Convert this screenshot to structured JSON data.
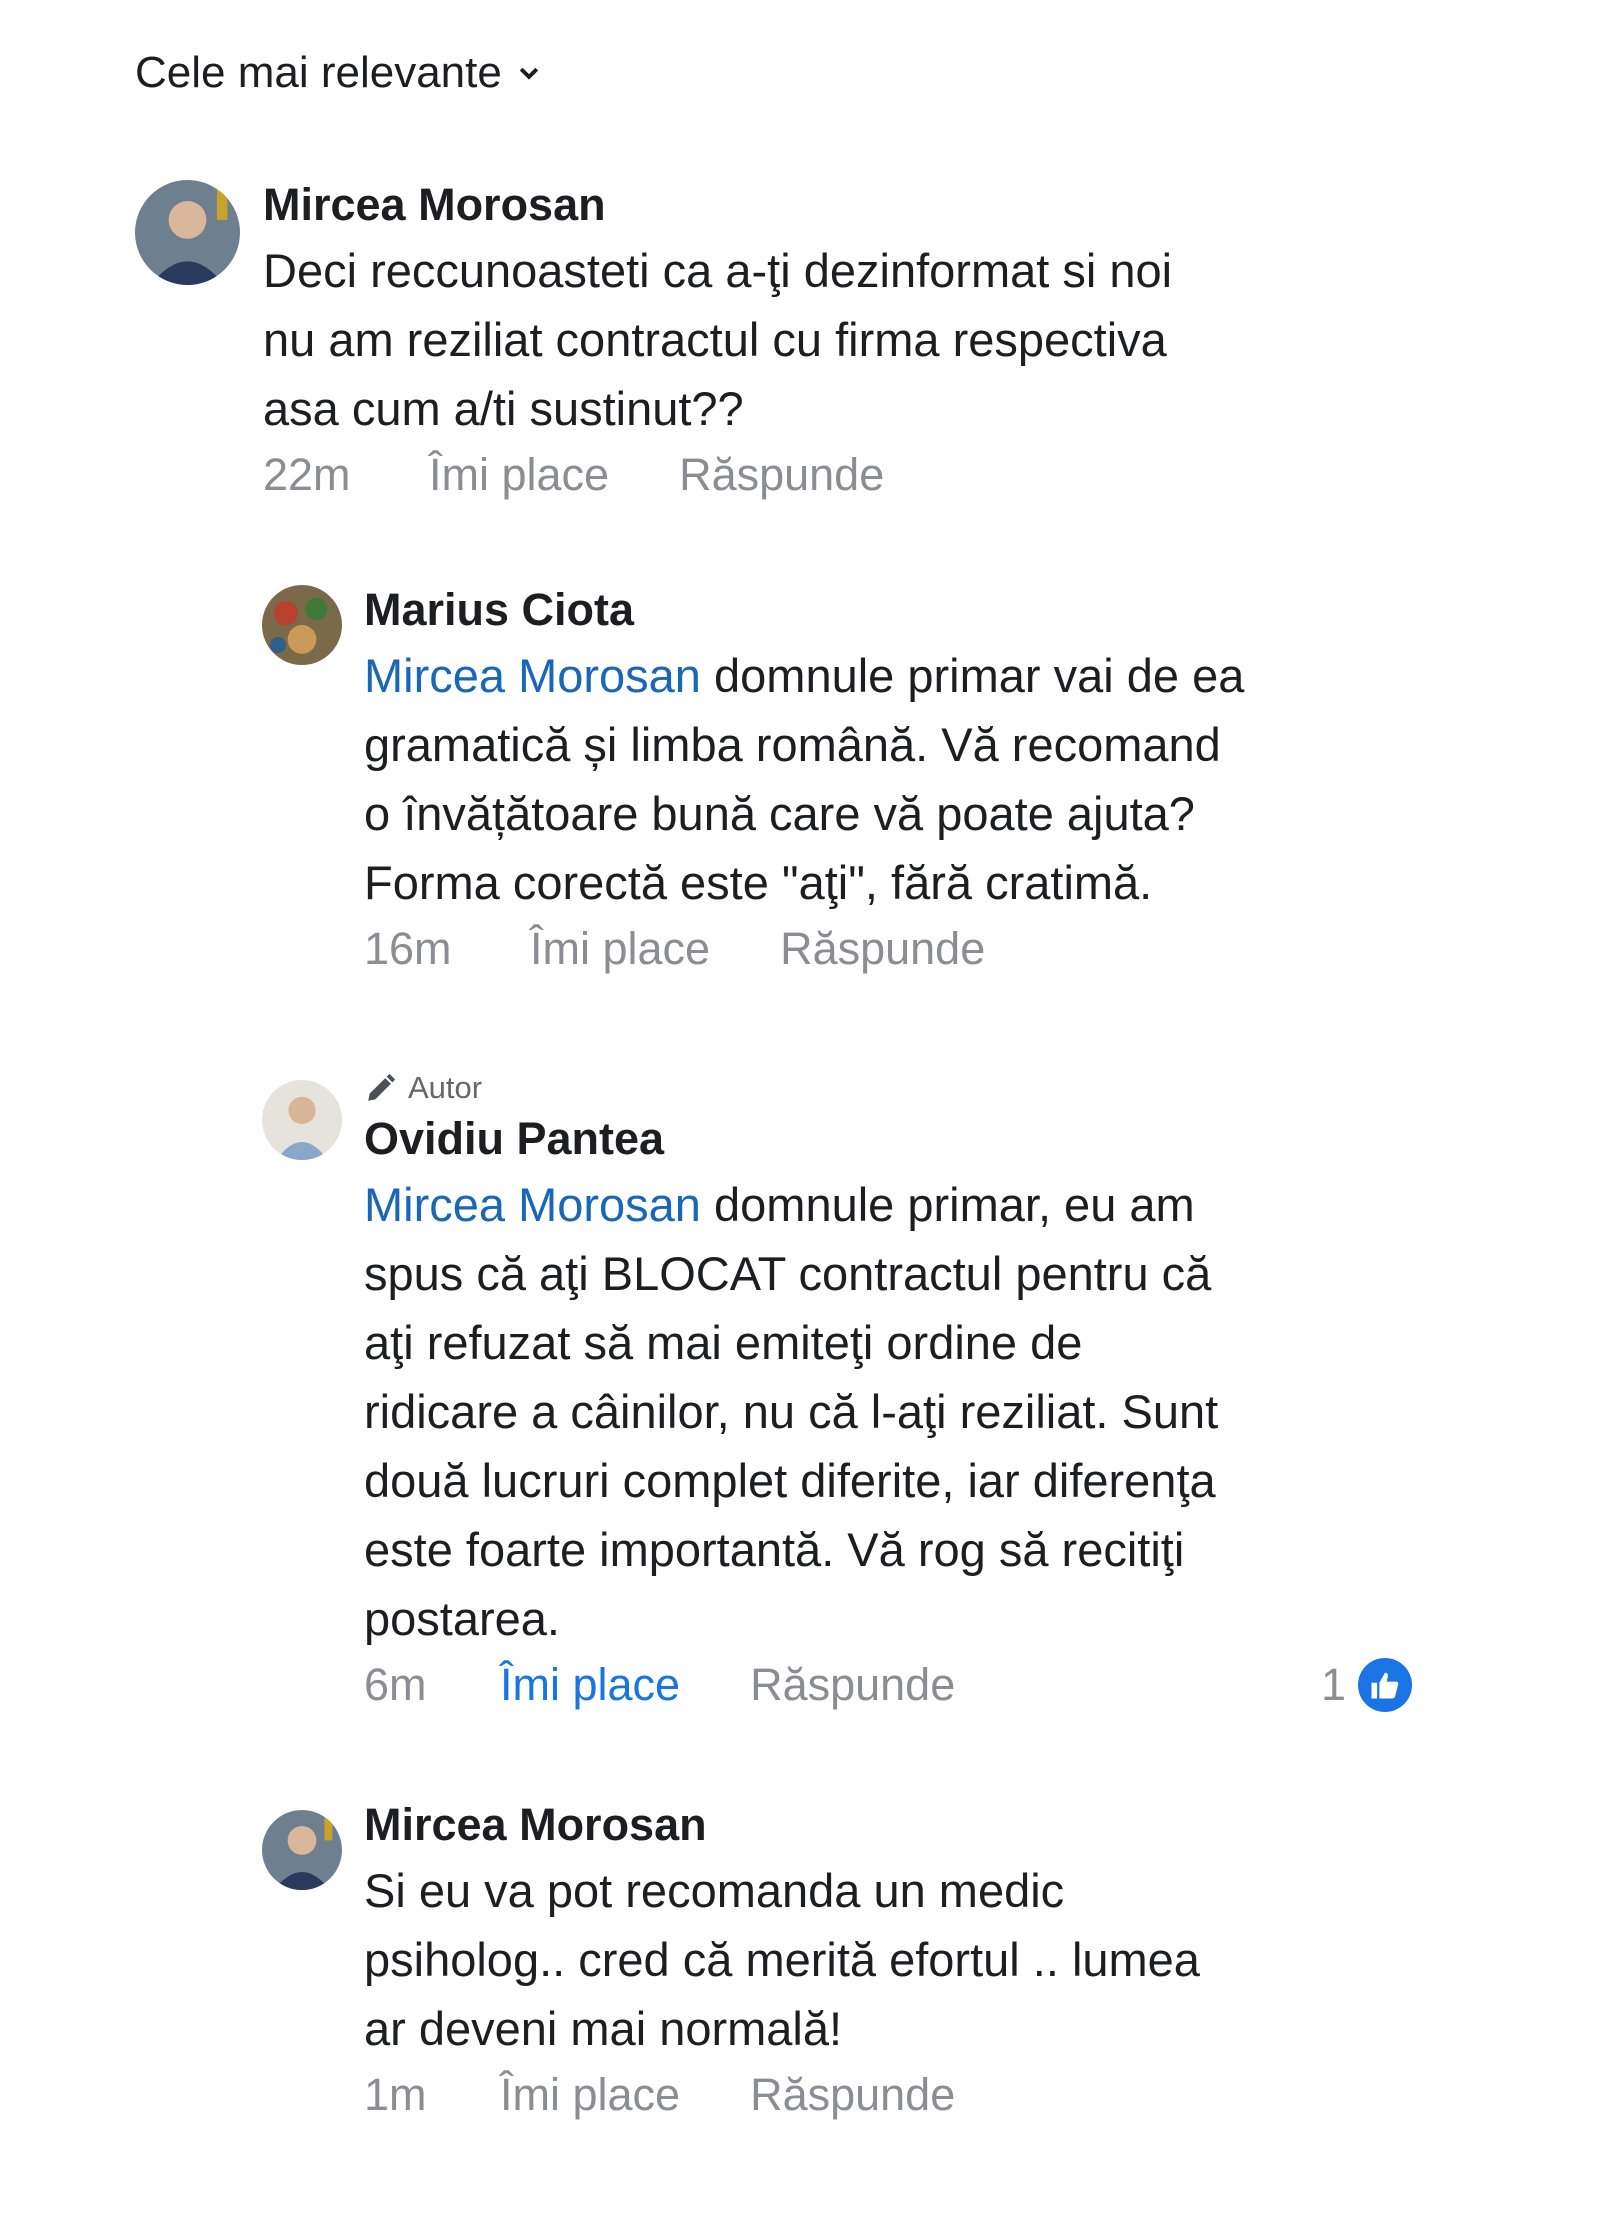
{
  "sort": {
    "label": "Cele mai relevante"
  },
  "comments": [
    {
      "name": "Mircea Morosan",
      "mention": "",
      "text": "Deci reccunoasteti ca a-ţi dezinformat si noi\nnu am reziliat contractul cu firma respectiva\nasa cum a/ti sustinut??",
      "time": "22m",
      "like": "Îmi place",
      "reply": "Răspunde"
    },
    {
      "name": "Marius Ciota",
      "mention": "Mircea Morosan",
      "text": " domnule primar vai de ea\ngramatică și limba română. Vă recomand\no învățătoare bună care vă poate ajuta?\nForma corectă este \"aţi\", fără cratimă.",
      "time": "16m",
      "like": "Îmi place",
      "reply": "Răspunde"
    },
    {
      "badge": "Autor",
      "name": "Ovidiu Pantea",
      "mention": "Mircea Morosan",
      "text": " domnule primar, eu am\nspus că aţi BLOCAT contractul pentru că\naţi refuzat să mai emiteţi ordine de\nridicare a câinilor, nu că l-aţi reziliat. Sunt\ndouă lucruri complet diferite, iar diferenţa\neste foarte importantă. Vă rog să recitiţi\npostarea.",
      "time": "6m",
      "like": "Îmi place",
      "reply": "Răspunde",
      "reaction_count": "1"
    },
    {
      "name": "Mircea Morosan",
      "mention": "",
      "text": "Si eu va pot recomanda un medic\npsiholog.. cred că merită efortul .. lumea\nar deveni mai normală!",
      "time": "1m",
      "like": "Îmi place",
      "reply": "Răspunde"
    }
  ],
  "colors": {
    "mention": "#1a66b8",
    "liked": "#1b74e4",
    "meta": "#8a8d91"
  }
}
